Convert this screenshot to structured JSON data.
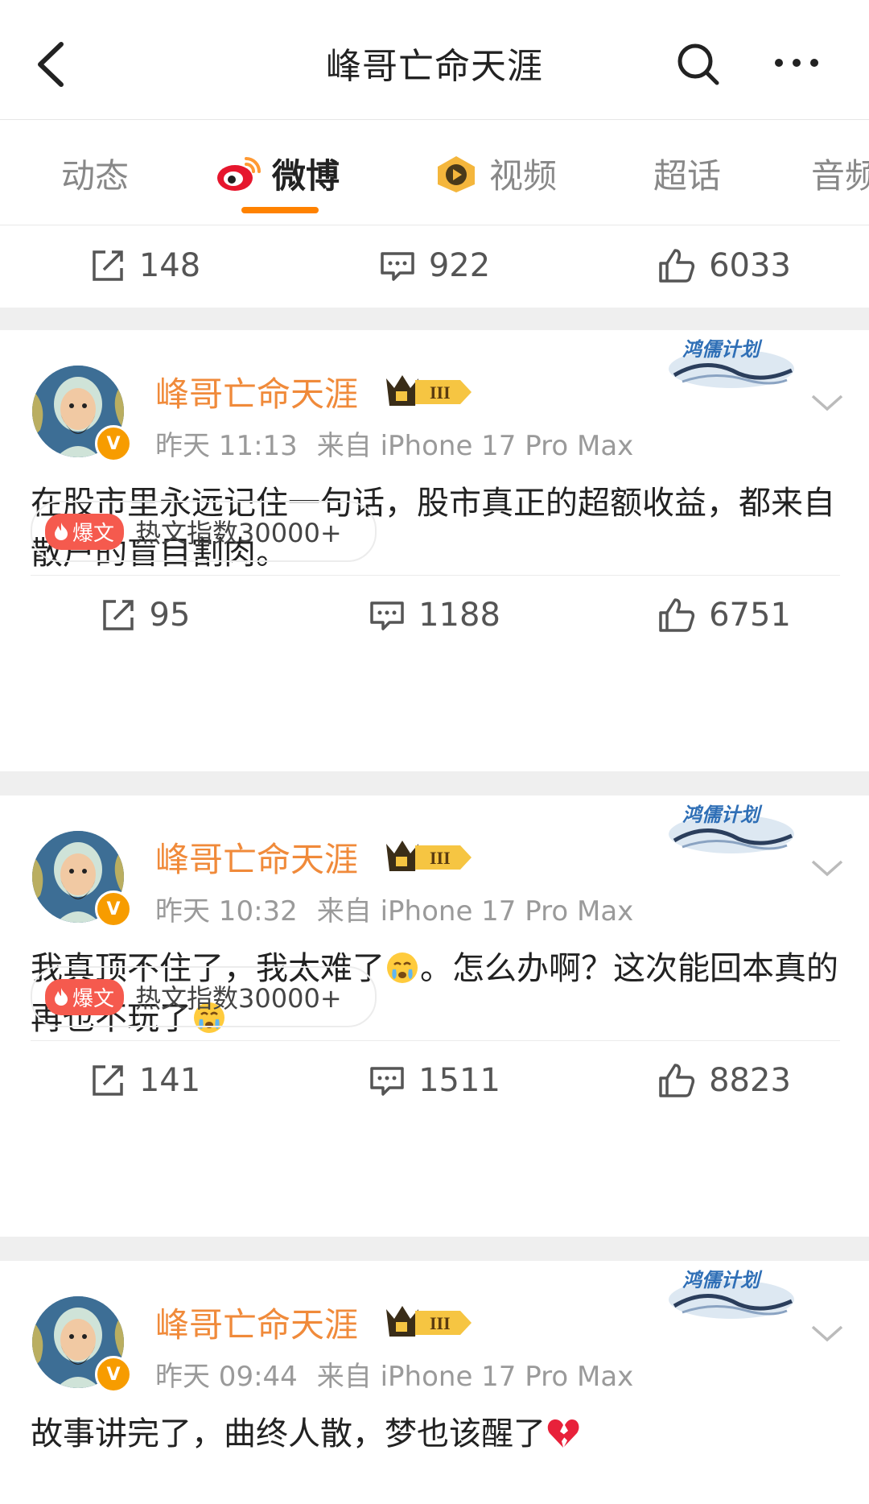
{
  "nav": {
    "title": "峰哥亡命天涯"
  },
  "tabs": [
    {
      "label": "动态"
    },
    {
      "label": "微博"
    },
    {
      "label": "视频"
    },
    {
      "label": "超话"
    },
    {
      "label": "音频"
    }
  ],
  "top_stats": {
    "reposts": "148",
    "comments": "922",
    "likes": "6033"
  },
  "posts": [
    {
      "author": "峰哥亡命天涯",
      "time": "昨天 11:13",
      "source": "来自 iPhone 17 Pro Max",
      "badge_text": "鸿儒计划",
      "text": "在股市里永远记住一句话，股市真正的超额收益，都来自散户的盲目割肉。",
      "hot_tag": "爆文",
      "hot_text": "热文指数30000+",
      "reposts": "95",
      "comments": "1188",
      "likes": "6751"
    },
    {
      "author": "峰哥亡命天涯",
      "time": "昨天 10:32",
      "source": "来自 iPhone 17 Pro Max",
      "badge_text": "鸿儒计划",
      "text_a": "我真顶不住了，我太难了",
      "text_b": "。怎么办啊？这次能回本真的再也不玩了",
      "hot_tag": "爆文",
      "hot_text": "热文指数30000+",
      "reposts": "141",
      "comments": "1511",
      "likes": "8823"
    },
    {
      "author": "峰哥亡命天涯",
      "time": "昨天 09:44",
      "source": "来自 iPhone 17 Pro Max",
      "badge_text": "鸿儒计划",
      "text": "故事讲完了，曲终人散，梦也该醒了"
    }
  ]
}
